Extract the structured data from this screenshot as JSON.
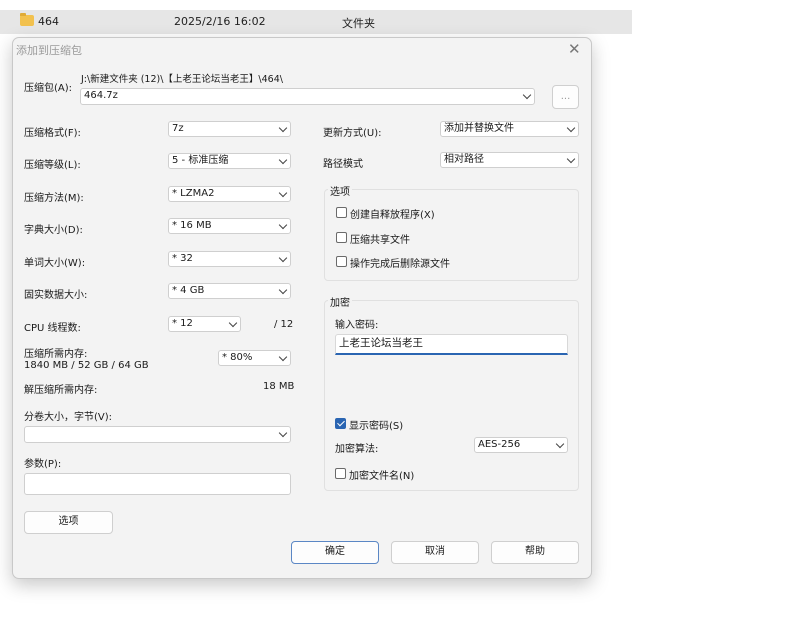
{
  "explorer": {
    "name": "464",
    "date": "2025/2/16 16:02",
    "type": "文件夹"
  },
  "dialog": {
    "title": "添加到压缩包",
    "close": "✕",
    "archive": {
      "label": "压缩包(A):",
      "path": "J:\\新建文件夹 (12)\\【上老王论坛当老王】\\464\\",
      "value": "464.7z",
      "browse": "..."
    },
    "left": {
      "format": {
        "label": "压缩格式(F):",
        "value": "7z"
      },
      "level": {
        "label": "压缩等级(L):",
        "value": "5 - 标准压缩"
      },
      "method": {
        "label": "压缩方法(M):",
        "value": "*  LZMA2"
      },
      "dict": {
        "label": "字典大小(D):",
        "value": "*  16 MB"
      },
      "word": {
        "label": "单词大小(W):",
        "value": "*  32"
      },
      "solid": {
        "label": "固实数据大小:",
        "value": "*  4 GB"
      },
      "threads": {
        "label": "CPU 线程数:",
        "value": "*  12",
        "total": "/ 12"
      },
      "memory": {
        "label": "压缩所需内存:",
        "detail": "1840 MB / 52 GB / 64 GB",
        "value": "*  80%"
      },
      "decomp": {
        "label": "解压缩所需内存:",
        "value": "18 MB"
      },
      "volume": {
        "label": "分卷大小，字节(V):",
        "value": ""
      },
      "params": {
        "label": "参数(P):",
        "value": ""
      },
      "options_button": "选项"
    },
    "right": {
      "update": {
        "label": "更新方式(U):",
        "value": "添加并替换文件"
      },
      "pathmode": {
        "label": "路径模式",
        "value": "相对路径"
      },
      "options": {
        "title": "选项",
        "sfx": "创建自释放程序(X)",
        "shared": "压缩共享文件",
        "delete": "操作完成后删除源文件"
      },
      "encryption": {
        "title": "加密",
        "pwd_label": "输入密码:",
        "pwd_value": "上老王论坛当老王",
        "show_pwd": "显示密码(S)",
        "algo_label": "加密算法:",
        "algo_value": "AES-256",
        "encrypt_names": "加密文件名(N)"
      }
    },
    "buttons": {
      "ok": "确定",
      "cancel": "取消",
      "help": "帮助"
    }
  }
}
